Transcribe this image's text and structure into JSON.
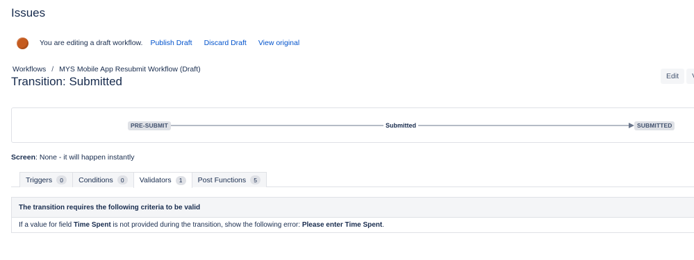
{
  "header": {
    "title": "Issues"
  },
  "draft_banner": {
    "message": "You are editing a draft workflow.",
    "publish_label": "Publish Draft",
    "discard_label": "Discard Draft",
    "view_original_label": "View original"
  },
  "breadcrumb": {
    "root": "Workflows",
    "separator": "/",
    "current": "MYS Mobile App Resubmit Workflow (Draft)"
  },
  "transition": {
    "title": "Transition: Submitted"
  },
  "actions": {
    "edit_label": "Edit",
    "view_label": "View"
  },
  "diagram": {
    "from_status": "PRE-SUBMIT",
    "transition_name": "Submitted",
    "to_status": "SUBMITTED"
  },
  "screen": {
    "label": "Screen",
    "value": ": None - it will happen instantly"
  },
  "tabs": [
    {
      "label": "Triggers",
      "count": "0"
    },
    {
      "label": "Conditions",
      "count": "0"
    },
    {
      "label": "Validators",
      "count": "1"
    },
    {
      "label": "Post Functions",
      "count": "5"
    }
  ],
  "active_tab": "Validators",
  "criteria": {
    "header": "The transition requires the following criteria to be valid",
    "rule": {
      "prefix": "If a value for field ",
      "field": "Time Spent",
      "middle": " is not provided during the transition, show the following error: ",
      "error": "Please enter Time Spent",
      "suffix": "."
    }
  },
  "colors": {
    "link": "#0052cc",
    "text": "#172b4d",
    "lozenge_bg": "#dfe1e6",
    "draft_icon": "#c55b1f"
  }
}
